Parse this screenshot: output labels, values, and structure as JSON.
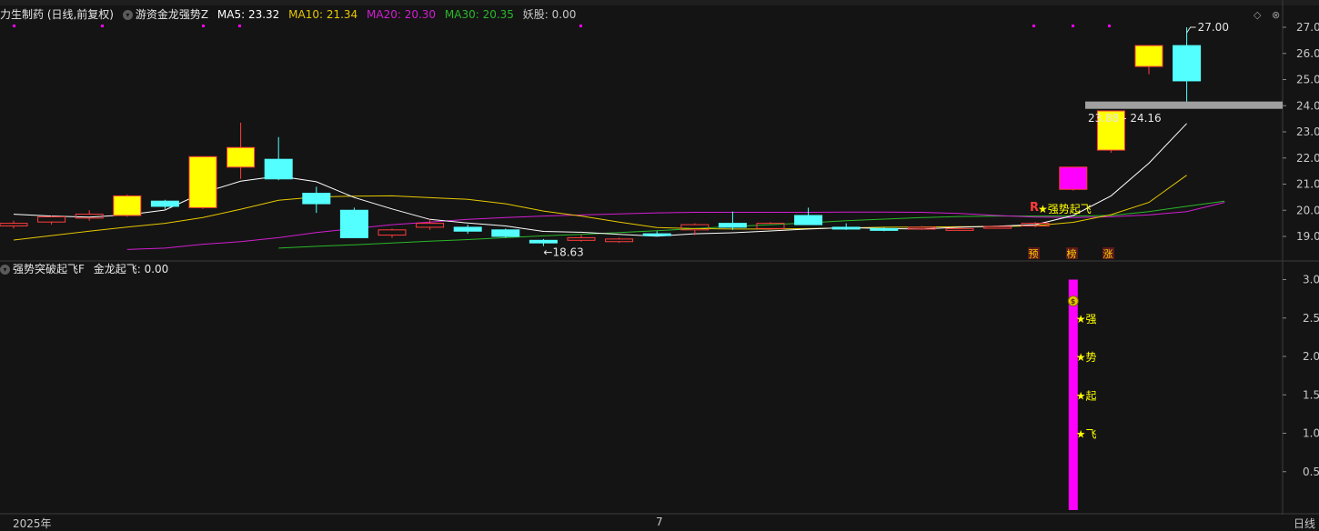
{
  "stock": {
    "title": "力生制药 (日线,前复权)",
    "indicator_name": "游资金龙强势Z",
    "ma5": {
      "label": "MA5: 23.32",
      "color": "#ffffff"
    },
    "ma10": {
      "label": "MA10: 21.34",
      "color": "#e6c800"
    },
    "ma20": {
      "label": "MA20: 20.30",
      "color": "#d21ed2"
    },
    "ma30": {
      "label": "MA30: 20.35",
      "color": "#2ab82a"
    },
    "yaogu": {
      "label": "妖股: 0.00",
      "color": "#c8c8c8"
    }
  },
  "sub_panel": {
    "title": "强势突破起飞F",
    "indicator": "金龙起飞: 0.00"
  },
  "window_controls": {
    "diamond": "◇",
    "close": "⊗"
  },
  "x_axis": {
    "start_label": "2025年",
    "mid_label": "7",
    "period_label": "日线"
  },
  "annotations": {
    "high_price": "27.00",
    "low_price": "18.63",
    "low_arrow": "←",
    "range_label": "23.88 - 24.16",
    "signal_text": "★强势起飞",
    "signal_R": "R",
    "tags": [
      "预",
      "榜",
      "涨"
    ],
    "sub_stars": [
      "★强",
      "★势",
      "★起",
      "★飞"
    ],
    "money_icon": "money-bag-icon"
  },
  "colors": {
    "up_body": "#ffff00",
    "up_border": "#ff3c3c",
    "down_body": "#54ffff",
    "magenta": "#ff00ff",
    "bg": "#141414",
    "grid": "#3c3c3c",
    "range_bar": "#a0a0a0"
  },
  "chart_data": [
    {
      "type": "candlestick",
      "title": "力生制药 (日线,前复权)",
      "ylim": [
        18.3,
        27.4
      ],
      "y_ticks": [
        19.0,
        20.0,
        21.0,
        22.0,
        23.0,
        24.0,
        25.0,
        26.0,
        27.0
      ],
      "y_tick_labels": [
        "19.00",
        "20.00",
        "21.00",
        "22.00",
        "23.00",
        "24.00",
        "25.00",
        "26.00",
        "27.00"
      ],
      "candles": [
        {
          "o": 19.4,
          "h": 19.6,
          "l": 19.3,
          "c": 19.5
        },
        {
          "o": 19.55,
          "h": 19.8,
          "l": 19.45,
          "c": 19.75
        },
        {
          "o": 19.7,
          "h": 20.0,
          "l": 19.6,
          "c": 19.85
        },
        {
          "o": 19.8,
          "h": 20.6,
          "l": 19.75,
          "c": 20.55
        },
        {
          "o": 20.35,
          "h": 20.4,
          "l": 20.05,
          "c": 20.15
        },
        {
          "o": 20.1,
          "h": 22.0,
          "l": 20.05,
          "c": 22.05
        },
        {
          "o": 21.65,
          "h": 23.35,
          "l": 21.2,
          "c": 22.4
        },
        {
          "o": 21.95,
          "h": 22.8,
          "l": 21.15,
          "c": 21.2
        },
        {
          "o": 20.65,
          "h": 20.9,
          "l": 19.9,
          "c": 20.25
        },
        {
          "o": 20.0,
          "h": 20.1,
          "l": 18.95,
          "c": 18.95
        },
        {
          "o": 19.05,
          "h": 19.3,
          "l": 18.95,
          "c": 19.25
        },
        {
          "o": 19.35,
          "h": 19.65,
          "l": 19.25,
          "c": 19.5
        },
        {
          "o": 19.35,
          "h": 19.45,
          "l": 19.1,
          "c": 19.2
        },
        {
          "o": 19.25,
          "h": 19.3,
          "l": 18.95,
          "c": 19.0
        },
        {
          "o": 18.85,
          "h": 18.9,
          "l": 18.63,
          "c": 18.75
        },
        {
          "o": 18.85,
          "h": 19.05,
          "l": 18.8,
          "c": 18.95
        },
        {
          "o": 18.8,
          "h": 18.95,
          "l": 18.75,
          "c": 18.9
        },
        {
          "o": 19.1,
          "h": 19.2,
          "l": 19.0,
          "c": 19.05
        },
        {
          "o": 19.25,
          "h": 19.5,
          "l": 19.05,
          "c": 19.45
        },
        {
          "o": 19.5,
          "h": 19.95,
          "l": 19.25,
          "c": 19.35
        },
        {
          "o": 19.3,
          "h": 19.55,
          "l": 19.25,
          "c": 19.5
        },
        {
          "o": 19.8,
          "h": 20.1,
          "l": 19.45,
          "c": 19.45
        },
        {
          "o": 19.35,
          "h": 19.5,
          "l": 19.25,
          "c": 19.3
        },
        {
          "o": 19.3,
          "h": 19.35,
          "l": 19.2,
          "c": 19.25
        },
        {
          "o": 19.3,
          "h": 19.4,
          "l": 19.25,
          "c": 19.35
        },
        {
          "o": 19.3,
          "h": 19.35,
          "l": 19.25,
          "c": 19.3
        },
        {
          "o": 19.35,
          "h": 19.4,
          "l": 19.3,
          "c": 19.38
        },
        {
          "o": 19.4,
          "h": 19.55,
          "l": 19.35,
          "c": 19.5
        },
        {
          "o": 20.8,
          "h": 21.65,
          "l": 20.75,
          "c": 21.65
        },
        {
          "o": 22.3,
          "h": 23.8,
          "l": 22.2,
          "c": 23.8
        },
        {
          "o": 25.5,
          "h": 26.3,
          "l": 25.2,
          "c": 26.3
        },
        {
          "o": 26.3,
          "h": 27.0,
          "l": 24.1,
          "c": 24.95
        }
      ],
      "ma_series": [
        {
          "name": "MA5",
          "values": [
            19.85,
            19.78,
            19.74,
            19.82,
            20.01,
            20.67,
            21.11,
            21.31,
            21.09,
            20.49,
            20.05,
            19.65,
            19.51,
            19.4,
            19.19,
            19.16,
            19.08,
            19.01,
            19.1,
            19.14,
            19.21,
            19.28,
            19.34,
            19.3,
            19.28,
            19.35,
            19.39,
            19.45,
            19.8,
            20.55,
            21.8,
            23.32
          ]
        },
        {
          "name": "MA10",
          "values": [
            18.86,
            19.03,
            19.2,
            19.36,
            19.5,
            19.72,
            20.04,
            20.38,
            20.51,
            20.54,
            20.55,
            20.48,
            20.42,
            20.25,
            19.97,
            19.78,
            19.55,
            19.34,
            19.3,
            19.28,
            19.28,
            19.3,
            19.32,
            19.35,
            19.36,
            19.37,
            19.38,
            19.41,
            19.54,
            19.83,
            20.3,
            21.34
          ]
        }
      ],
      "ma20_values": {
        "start_index": 3,
        "values": [
          18.5,
          18.55,
          18.7,
          18.8,
          18.95,
          19.15,
          19.3,
          19.45,
          19.55,
          19.65,
          19.72,
          19.78,
          19.82,
          19.86,
          19.9,
          19.92,
          19.92,
          19.92,
          19.92,
          19.93,
          19.93,
          19.92,
          19.88,
          19.8,
          19.74,
          19.72,
          19.75,
          19.82,
          19.95,
          20.3
        ]
      },
      "ma30_values": {
        "start_index": 7,
        "values": [
          18.55,
          18.62,
          18.68,
          18.75,
          18.82,
          18.88,
          18.95,
          19.02,
          19.08,
          19.15,
          19.22,
          19.3,
          19.38,
          19.45,
          19.52,
          19.6,
          19.66,
          19.72,
          19.76,
          19.78,
          19.78,
          19.78,
          19.8,
          19.95,
          20.15,
          20.35
        ]
      }
    },
    {
      "type": "bar",
      "title": "强势突破起飞F",
      "ylim": [
        0,
        3.1
      ],
      "y_ticks": [
        0.5,
        1.0,
        1.5,
        2.0,
        2.5,
        3.0
      ],
      "y_tick_labels": [
        "0.5",
        "1.0",
        "1.5",
        "2.0",
        "2.5",
        "3.0"
      ],
      "bars": [
        {
          "index": 28,
          "value": 3.0
        }
      ]
    }
  ]
}
